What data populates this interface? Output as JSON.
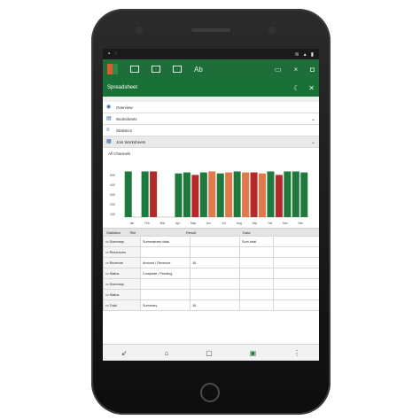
{
  "statusbar": {
    "time": "",
    "icons": [
      "notification-icon",
      "sync-icon",
      "wifi-icon",
      "signal-icon",
      "battery-icon"
    ]
  },
  "toolbar": {
    "text_icon": "Ab"
  },
  "titlebar": {
    "title": "Spreadsheet"
  },
  "options": [
    {
      "label": "Overview",
      "icon": "eye-icon",
      "chevron": false
    },
    {
      "label": "Worksheets",
      "icon": "sheet-icon",
      "chevron": true
    },
    {
      "label": "Statistics",
      "icon": "list-icon",
      "chevron": false
    },
    {
      "label": "Join Worksheets",
      "icon": "calendar-icon",
      "chevron": true
    }
  ],
  "chart_data": {
    "type": "bar",
    "title": "All Channels",
    "y_tick_labels": [
      "500",
      "400",
      "300",
      "200",
      "100"
    ],
    "categories": [
      "Jan",
      "Feb",
      "Mar",
      "Apr",
      "May",
      "Jun",
      "Jul",
      "Aug",
      "Sep",
      "Oct",
      "Nov",
      "Dec",
      "Jan",
      "Feb",
      "Mar",
      "Apr",
      "May",
      "Jun",
      "Jul",
      "Aug",
      "Sep",
      "Oct"
    ],
    "values": [
      92,
      0,
      92,
      92,
      0,
      0,
      88,
      90,
      85,
      90,
      92,
      88,
      90,
      92,
      90,
      90,
      88,
      92,
      85,
      92,
      92,
      90
    ],
    "colors": [
      "#1e7a3c",
      "#ffffff",
      "#1e7a3c",
      "#b42a2a",
      "#ffffff",
      "#ffffff",
      "#1e7a3c",
      "#1e7a3c",
      "#b42a2a",
      "#1e7a3c",
      "#e07a4a",
      "#1e7a3c",
      "#e07a4a",
      "#1e7a3c",
      "#e07a4a",
      "#b42a2a",
      "#e07a4a",
      "#1e7a3c",
      "#b42a2a",
      "#1e7a3c",
      "#1e7a3c",
      "#1e7a3c"
    ],
    "x_tick_labels": [
      "Jan",
      "Feb",
      "Mar",
      "Apr",
      "May",
      "Jun",
      "Jul",
      "Aug",
      "Sep",
      "Oct",
      "Nov",
      "Dec"
    ],
    "ylim": [
      0,
      100
    ],
    "grid": false
  },
  "table": {
    "header": [
      "Statistics",
      "Title",
      "Result",
      "Data"
    ],
    "rows": [
      [
        "Summary",
        "Summarized data",
        "",
        "Sum total"
      ],
      [
        "Resources",
        "",
        "",
        ""
      ],
      [
        "Revenue",
        "Amount / Revenue",
        "15",
        ""
      ],
      [
        "Status",
        "Complete / Pending",
        "",
        ""
      ],
      [
        "Summary",
        "",
        "",
        ""
      ],
      [
        "Status",
        "",
        "",
        ""
      ],
      [
        "Total",
        "Summary",
        "15",
        ""
      ]
    ]
  },
  "navbar": {
    "icons": [
      "back-icon",
      "home-icon",
      "recent-icon",
      "sheet-icon",
      "more-icon"
    ]
  }
}
